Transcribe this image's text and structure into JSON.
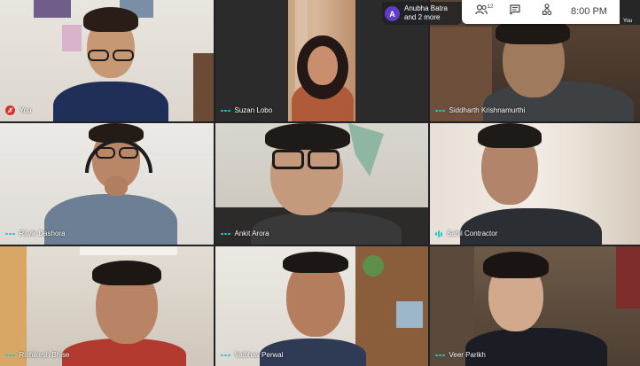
{
  "participants": [
    {
      "name": "You",
      "audio": "muted"
    },
    {
      "name": "Suzan Lobo",
      "audio": "idle"
    },
    {
      "name": "Siddharth Krishnamurthi",
      "audio": "idle"
    },
    {
      "name": "Ritvik Dashora",
      "audio": "idle"
    },
    {
      "name": "Ankit Arora",
      "audio": "idle"
    },
    {
      "name": "Sahil Contractor",
      "audio": "speaking"
    },
    {
      "name": "Rishikesh Bhise",
      "audio": "idle"
    },
    {
      "name": "Vaibhav Perwal",
      "audio": "idle"
    },
    {
      "name": "Veer Parikh",
      "audio": "idle"
    }
  ],
  "presenting": {
    "avatar_letter": "A",
    "line1": "Anubha Batra",
    "line2": "and 2 more"
  },
  "toolbar": {
    "people_count": "12",
    "people_icon": "people-icon",
    "chat_icon": "chat-icon",
    "activities_icon": "activities-icon",
    "time": "8:00 PM",
    "self_label": "You"
  },
  "colors": {
    "accent": "#29c5ca",
    "muted_red": "#d93025",
    "background": "#202124"
  }
}
